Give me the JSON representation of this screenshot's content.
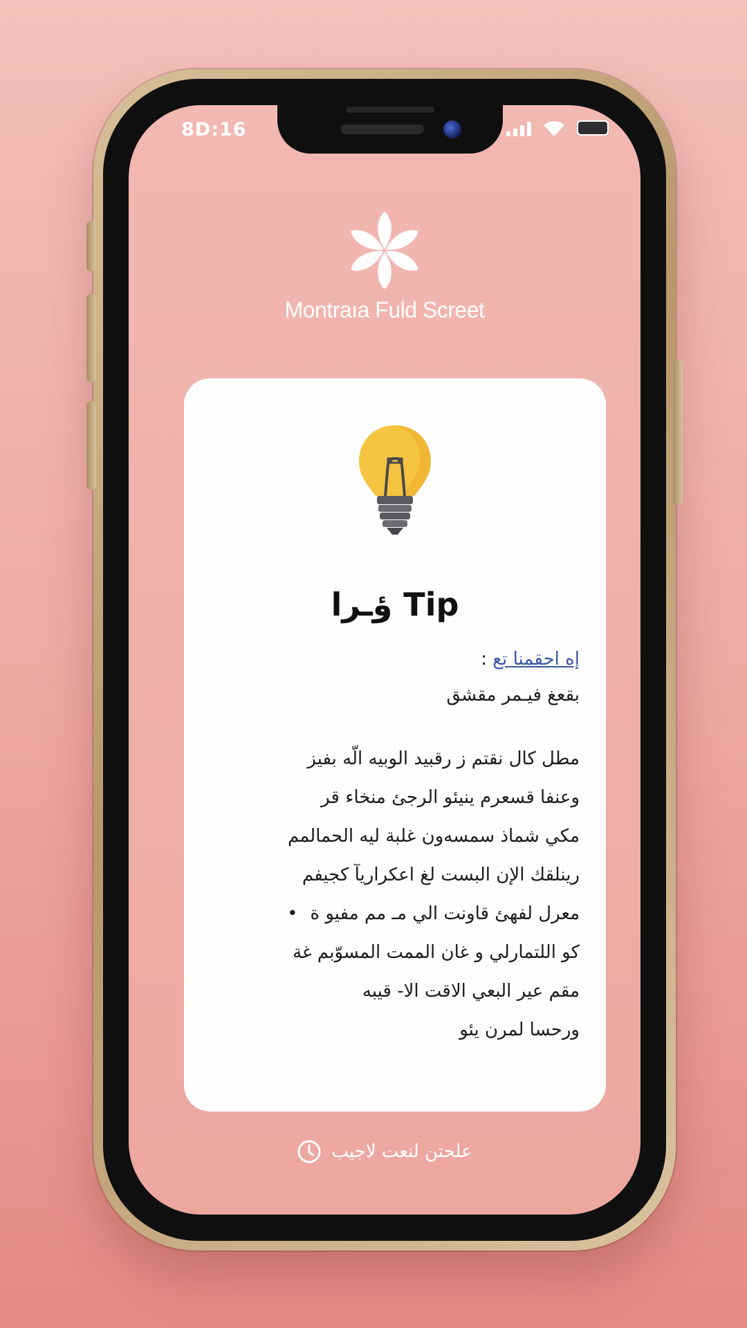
{
  "status_bar": {
    "time": "8D:16"
  },
  "brand": {
    "name": "Montraıa Fuld Screet",
    "logo_icon": "flower-icon"
  },
  "tip_card": {
    "icon": "lightbulb-icon",
    "title": "ؤـرا Tip",
    "intro_link": "إه احقمنا تع",
    "intro_colon": ":",
    "intro_line2": "بقعغ فيـمر مقشق",
    "body_lines": [
      "مطل كال نقتم ز رقبيد الوبيه الّه بفيز",
      "وعنفا قسعرم ينيئو الرجئ منخاء قر",
      "مكي شماذ سمسه‌ون غلبة ليه الحمالمم",
      "رينلقك الإن البست لغ اعكراريآ كجيفم",
      "معرل لفهئ قاونت الي مـ مم مفيو ة",
      "كو اللتمارلي و غان الممت المسوّبم غة",
      "مقم عير البعي الاقت الا- قيبه",
      "ورحسا لمرن يئو"
    ],
    "bullet_line_index": 4,
    "bullet_glyph": "•"
  },
  "footer": {
    "text": "علحتن لنعت لاجيب",
    "icon": "clock-icon"
  },
  "colors": {
    "background": "#eda7a1",
    "card": "#fefefe",
    "accent_link": "#3b57a4",
    "bulb": "#f5c542"
  }
}
